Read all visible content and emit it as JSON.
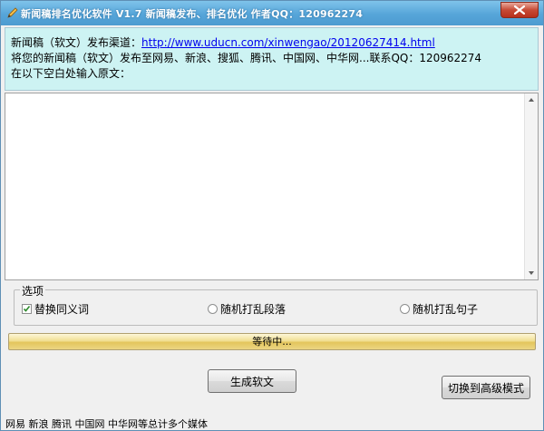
{
  "window": {
    "title": "新闻稿排名优化软件 V1.7   新闻稿发布、排名优化   作者QQ：120962274"
  },
  "info": {
    "line1_prefix": "新闻稿（软文）发布渠道：",
    "link": "http://www.uducn.com/xinwengao/20120627414.html",
    "line2": "将您的新闻稿（软文）发布至网易、新浪、搜狐、腾讯、中国网、中华网...联系QQ：120962274",
    "line3": "在以下空白处输入原文："
  },
  "editor": {
    "value": ""
  },
  "options": {
    "legend": "选项",
    "synonym": {
      "label": "替换同义词",
      "checked": true
    },
    "shuffle_paragraphs": {
      "label": "随机打乱段落",
      "selected": false
    },
    "shuffle_sentences": {
      "label": "随机打乱句子",
      "selected": false
    }
  },
  "progress": {
    "label": "等待中..."
  },
  "buttons": {
    "generate": "生成软文",
    "advanced": "切换到高级模式"
  },
  "footer": {
    "text": "网易 新浪 腾讯 中国网 中华网等总计多个媒体"
  },
  "colors": {
    "titlebar": "#56a5d9",
    "info_bg": "#cdf3f3",
    "close": "#c74a35",
    "progress": "#f1df93"
  }
}
